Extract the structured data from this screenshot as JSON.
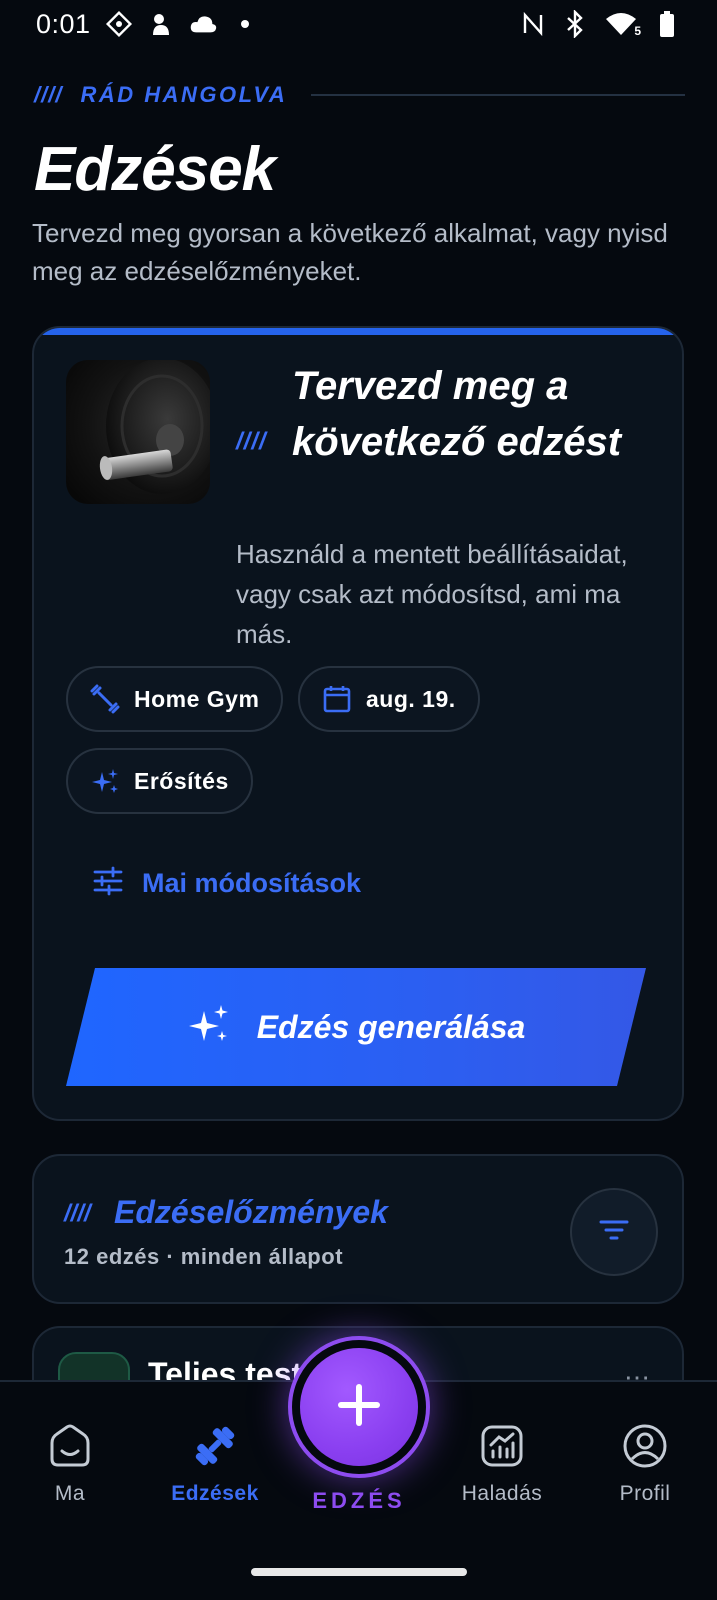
{
  "status_bar": {
    "time": "0:01",
    "left_icons": [
      "grid-badge-icon",
      "android-icon",
      "cloud-icon",
      "dot-icon"
    ],
    "right_icons": [
      "nfc-icon",
      "bluetooth-icon",
      "wifi-icon",
      "battery-icon"
    ],
    "wifi_badge": "5"
  },
  "header": {
    "slashes": "////",
    "eyebrow": "RÁD HANGOLVA",
    "title": "Edzések",
    "subtitle": "Tervezd meg gyorsan a következő alkalmat, vagy nyisd meg az edzéselőzményeket."
  },
  "plan_card": {
    "slashes": "////",
    "title": "Tervezd meg a következő edzést",
    "description": "Használd a mentett beállításaidat, vagy csak azt módosítsd, ami ma más.",
    "chips": [
      {
        "icon": "dumbbell-icon",
        "label": "Home Gym"
      },
      {
        "icon": "calendar-icon",
        "label": "aug. 19."
      },
      {
        "icon": "sparkle-icon",
        "label": "Erősítés"
      }
    ],
    "modifications_label": "Mai módosítások",
    "generate_label": "Edzés generálása",
    "accent_color": "#2563eb"
  },
  "history": {
    "slashes": "////",
    "title": "Edzéselőzmények",
    "subtitle": "12 edzés · minden állapot"
  },
  "workout_preview": {
    "title": "Teljes test",
    "more": "⋯"
  },
  "bottom_nav": {
    "items": [
      {
        "icon": "home-icon",
        "label": "Ma",
        "active": false
      },
      {
        "icon": "dumbbell-icon",
        "label": "Edzések",
        "active": true
      },
      {
        "icon": "chart-icon",
        "label": "Haladás",
        "active": false
      },
      {
        "icon": "profile-icon",
        "label": "Profil",
        "active": false
      }
    ],
    "fab_label": "EDZÉS",
    "fab_color": "#8d4cf0"
  }
}
